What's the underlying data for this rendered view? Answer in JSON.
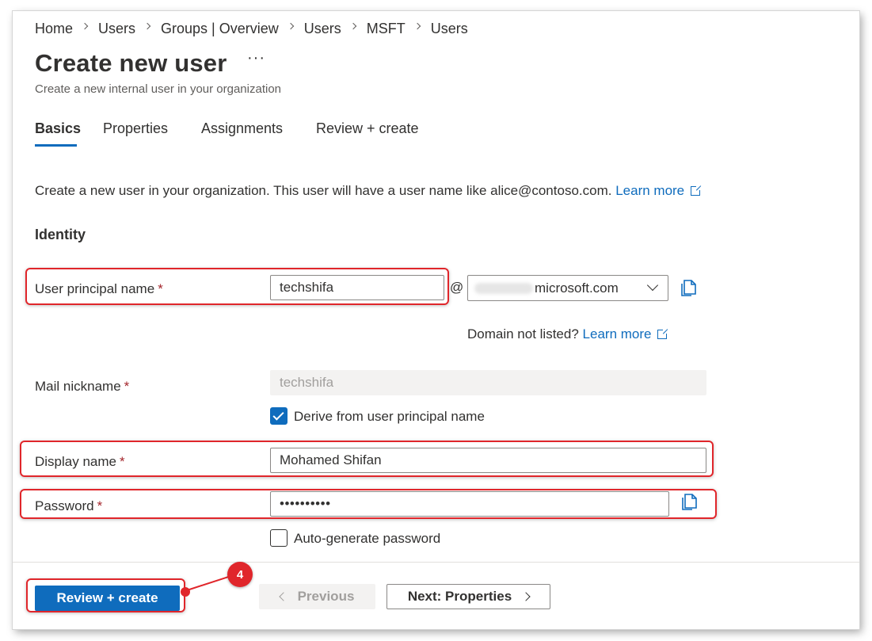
{
  "breadcrumb": [
    "Home",
    "Users",
    "Groups | Overview",
    "Users",
    "MSFT",
    "Users"
  ],
  "page": {
    "title": "Create new user",
    "more_label": "···",
    "subtitle": "Create a new internal user in your organization"
  },
  "tabs": [
    {
      "label": "Basics",
      "active": true
    },
    {
      "label": "Properties",
      "active": false
    },
    {
      "label": "Assignments",
      "active": false
    },
    {
      "label": "Review + create",
      "active": false
    }
  ],
  "intro": {
    "text": "Create a new user in your organization. This user will have a user name like alice@contoso.com.",
    "link": "Learn more"
  },
  "section_title": "Identity",
  "fields": {
    "upn": {
      "label": "User principal name",
      "required": "*",
      "value": "techshifa",
      "at": "@",
      "domain": "microsoft.com"
    },
    "domain_note": {
      "text": "Domain not listed?",
      "link": "Learn more"
    },
    "mail_nickname": {
      "label": "Mail nickname",
      "required": "*",
      "value": "techshifa"
    },
    "derive": {
      "label": "Derive from user principal name",
      "checked": true
    },
    "display_name": {
      "label": "Display name",
      "required": "*",
      "value": "Mohamed Shifan"
    },
    "password": {
      "label": "Password",
      "required": "*",
      "value": "••••••••••"
    },
    "auto_generate": {
      "label": "Auto-generate password",
      "checked": false
    }
  },
  "footer": {
    "review_create": "Review + create",
    "previous": "Previous",
    "next": "Next: Properties"
  },
  "annotation": {
    "step": "4"
  },
  "colors": {
    "accent": "#0f6cbd",
    "highlight": "#e0262b",
    "required": "#a4262c",
    "text": "#323130"
  },
  "icons": {
    "copy": "copy-icon",
    "external_link": "external-link-icon",
    "dropdown": "chevron-down-icon",
    "breadcrumb_separator": "chevron-right-icon"
  }
}
